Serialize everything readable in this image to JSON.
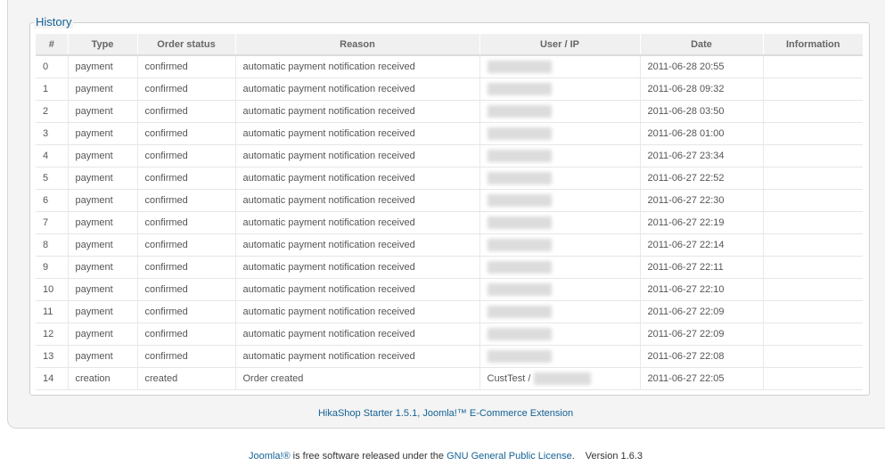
{
  "history": {
    "legend": "History",
    "columns": [
      "#",
      "Type",
      "Order status",
      "Reason",
      "User / IP",
      "Date",
      "Information"
    ],
    "rows": [
      {
        "num": "0",
        "type": "payment",
        "status": "confirmed",
        "reason": "automatic payment notification received",
        "user": "",
        "date": "2011-06-28 20:55",
        "info": ""
      },
      {
        "num": "1",
        "type": "payment",
        "status": "confirmed",
        "reason": "automatic payment notification received",
        "user": "",
        "date": "2011-06-28 09:32",
        "info": ""
      },
      {
        "num": "2",
        "type": "payment",
        "status": "confirmed",
        "reason": "automatic payment notification received",
        "user": "",
        "date": "2011-06-28 03:50",
        "info": ""
      },
      {
        "num": "3",
        "type": "payment",
        "status": "confirmed",
        "reason": "automatic payment notification received",
        "user": "",
        "date": "2011-06-28 01:00",
        "info": ""
      },
      {
        "num": "4",
        "type": "payment",
        "status": "confirmed",
        "reason": "automatic payment notification received",
        "user": "",
        "date": "2011-06-27 23:34",
        "info": ""
      },
      {
        "num": "5",
        "type": "payment",
        "status": "confirmed",
        "reason": "automatic payment notification received",
        "user": "",
        "date": "2011-06-27 22:52",
        "info": ""
      },
      {
        "num": "6",
        "type": "payment",
        "status": "confirmed",
        "reason": "automatic payment notification received",
        "user": "",
        "date": "2011-06-27 22:30",
        "info": ""
      },
      {
        "num": "7",
        "type": "payment",
        "status": "confirmed",
        "reason": "automatic payment notification received",
        "user": "",
        "date": "2011-06-27 22:19",
        "info": ""
      },
      {
        "num": "8",
        "type": "payment",
        "status": "confirmed",
        "reason": "automatic payment notification received",
        "user": "",
        "date": "2011-06-27 22:14",
        "info": ""
      },
      {
        "num": "9",
        "type": "payment",
        "status": "confirmed",
        "reason": "automatic payment notification received",
        "user": "",
        "date": "2011-06-27 22:11",
        "info": ""
      },
      {
        "num": "10",
        "type": "payment",
        "status": "confirmed",
        "reason": "automatic payment notification received",
        "user": "",
        "date": "2011-06-27 22:10",
        "info": ""
      },
      {
        "num": "11",
        "type": "payment",
        "status": "confirmed",
        "reason": "automatic payment notification received",
        "user": "",
        "date": "2011-06-27 22:09",
        "info": ""
      },
      {
        "num": "12",
        "type": "payment",
        "status": "confirmed",
        "reason": "automatic payment notification received",
        "user": "",
        "date": "2011-06-27 22:09",
        "info": ""
      },
      {
        "num": "13",
        "type": "payment",
        "status": "confirmed",
        "reason": "automatic payment notification received",
        "user": "",
        "date": "2011-06-27 22:08",
        "info": ""
      },
      {
        "num": "14",
        "type": "creation",
        "status": "created",
        "reason": "Order created",
        "user": "CustTest /",
        "date": "2011-06-27 22:05",
        "info": ""
      }
    ]
  },
  "footer": {
    "extension_link": "HikaShop Starter 1.5.1, Joomla!™ E-Commerce Extension",
    "joomla_link": "Joomla!®",
    "joomla_text": " is free software released under the ",
    "license_link": "GNU General Public License",
    "license_period": ".",
    "version": "Version 1.6.3"
  },
  "colors": {
    "link": "#146295",
    "header_bg": "#f0f0f0",
    "panel_bg": "#f4f4f4"
  }
}
